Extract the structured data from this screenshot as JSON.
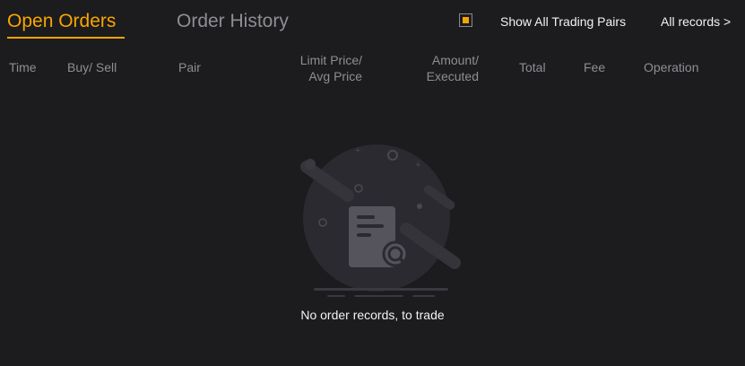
{
  "tabs": {
    "open_orders": "Open Orders",
    "order_history": "Order History"
  },
  "header": {
    "show_all_label": "Show All Trading Pairs",
    "show_all_checked": true,
    "all_records_label": "All records >"
  },
  "columns": {
    "time": "Time",
    "buy_sell": "Buy/ Sell",
    "pair": "Pair",
    "limit_price_line1": "Limit Price/",
    "limit_price_line2": "Avg Price",
    "amount_line1": "Amount/",
    "amount_line2": "Executed",
    "total": "Total",
    "fee": "Fee",
    "operation": "Operation"
  },
  "empty_state": {
    "message": "No order records, to trade",
    "icon": "document-search-icon"
  },
  "colors": {
    "accent": "#f7a600",
    "background": "#1c1b1e",
    "text_primary": "#f2f2f2",
    "text_secondary": "#8e8e93"
  }
}
